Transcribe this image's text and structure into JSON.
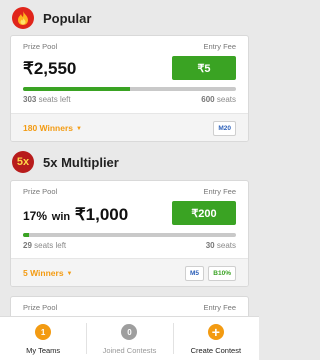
{
  "sections": [
    {
      "title": "Popular",
      "icon": "fire-icon"
    },
    {
      "title": "5x Multiplier",
      "icon": "multiplier-5x-icon",
      "icon_text": "5x"
    }
  ],
  "contests": [
    {
      "prize_pool_label": "Prize Pool",
      "entry_fee_label": "Entry Fee",
      "prize": "₹2,550",
      "entry_fee": "₹5",
      "fill_fraction": 0.5,
      "seats_left": "303",
      "seats_left_label": "seats left",
      "total_seats": "600",
      "total_seats_label": "seats",
      "winners": "180 Winners",
      "tags": [
        "M20"
      ]
    },
    {
      "prize_pool_label": "Prize Pool",
      "entry_fee_label": "Entry Fee",
      "win_pct": "17%",
      "win_word": "win",
      "prize": "₹1,000",
      "entry_fee": "₹200",
      "fill_fraction": 0.03,
      "seats_left": "29",
      "seats_left_label": "seats left",
      "total_seats": "30",
      "total_seats_label": "seats",
      "winners": "5 Winners",
      "tags": [
        "M5",
        "B10%"
      ]
    },
    {
      "prize_pool_label": "Prize Pool",
      "entry_fee_label": "Entry Fee"
    }
  ],
  "bottom_nav": [
    {
      "label": "My Teams",
      "badge": "1"
    },
    {
      "label": "Joined Contests",
      "badge": "0"
    },
    {
      "label": "Create Contest",
      "icon": "plus-icon"
    }
  ],
  "colors": {
    "accent_orange": "#f39b12",
    "fee_green": "#3aa323",
    "fire_red": "#e0251b"
  }
}
